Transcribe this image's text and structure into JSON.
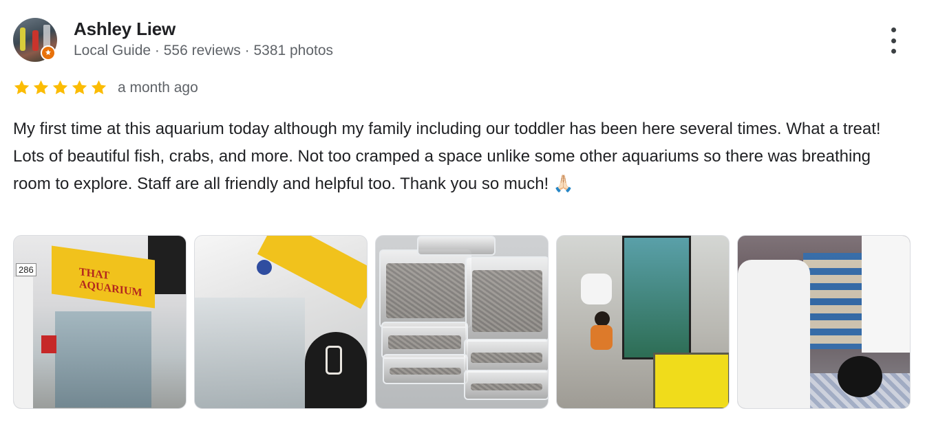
{
  "reviewer": {
    "name": "Ashley Liew",
    "meta": "Local Guide · 556 reviews · 5381 photos"
  },
  "review": {
    "rating": 5,
    "max_rating": 5,
    "date": "a month ago",
    "text": "My first time at this aquarium today although my family including our toddler has been here several times. What a treat! Lots of beautiful fish, crabs, and more. Not too cramped a space unlike some other aquariums so there was breathing room to explore. Staff are all friendly and helpful too. Thank you so much! 🙏🏻"
  },
  "photos": {
    "count": 5,
    "sign_text": "THAT AQUARIUM",
    "unit_number": "286"
  },
  "colors": {
    "star": "#fbbc04",
    "guide_badge": "#e8710a",
    "secondary_text": "#5f6368"
  }
}
